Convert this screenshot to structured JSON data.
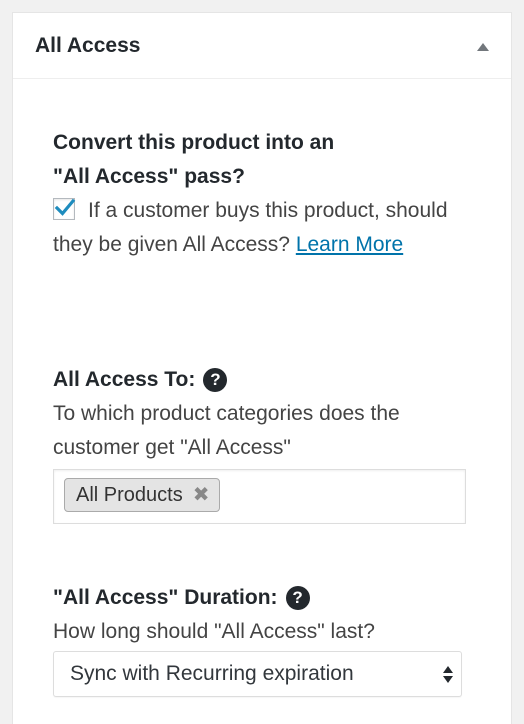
{
  "panel": {
    "title": "All Access"
  },
  "convert": {
    "heading_line1": "Convert this product into an",
    "heading_line2": "\"All Access\" pass?",
    "checkbox_checked": true,
    "description": "If a customer buys this product, should they be given All Access?",
    "learn_more": "Learn More"
  },
  "access_to": {
    "heading": "All Access To:",
    "help_icon": "question-circle-icon",
    "description": "To which product categories does the customer get \"All Access\"",
    "tags": [
      "All Products"
    ],
    "tag_remove_glyph": "✖"
  },
  "duration": {
    "heading": "\"All Access\" Duration:",
    "help_icon": "question-circle-icon",
    "description": "How long should \"All Access\" last?",
    "selected": "Sync with Recurring expiration"
  },
  "colors": {
    "link": "#0073aa",
    "checkmark": "#1e8cbe"
  }
}
